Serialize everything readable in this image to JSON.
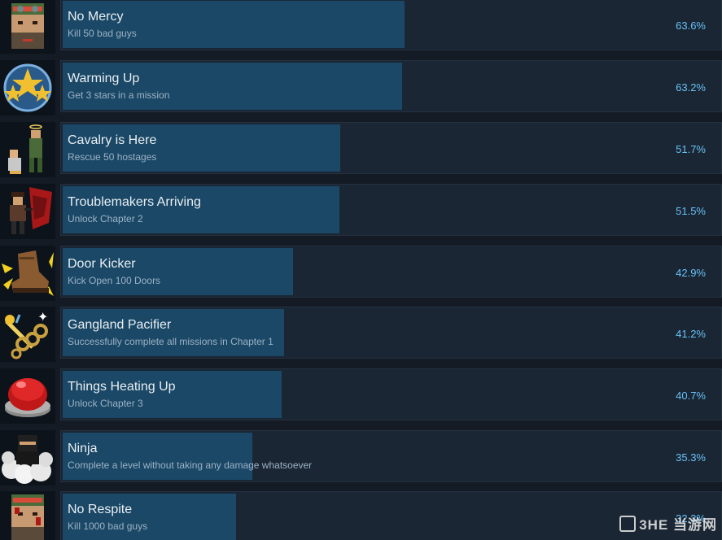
{
  "achievements": [
    {
      "title": "No Mercy",
      "description": "Kill 50 bad guys",
      "percent_label": "63.6%",
      "percent": 63.6,
      "icon": "soldier-face-icon"
    },
    {
      "title": "Warming Up",
      "description": "Get 3 stars in a mission",
      "percent_label": "63.2%",
      "percent": 63.2,
      "icon": "three-stars-badge-icon"
    },
    {
      "title": "Cavalry is Here",
      "description": "Rescue 50 hostages",
      "percent_label": "51.7%",
      "percent": 51.7,
      "icon": "soldier-hostage-icon"
    },
    {
      "title": "Troublemakers Arriving",
      "description": "Unlock Chapter 2",
      "percent_label": "51.5%",
      "percent": 51.5,
      "icon": "gunman-red-flag-icon"
    },
    {
      "title": "Door Kicker",
      "description": "Kick Open 100 Doors",
      "percent_label": "42.9%",
      "percent": 42.9,
      "icon": "kicking-boot-icon"
    },
    {
      "title": "Gangland Pacifier",
      "description": "Successfully complete all missions in Chapter 1",
      "percent_label": "41.2%",
      "percent": 41.2,
      "icon": "brass-knuckles-icon"
    },
    {
      "title": "Things Heating Up",
      "description": "Unlock Chapter 3",
      "percent_label": "40.7%",
      "percent": 40.7,
      "icon": "red-alarm-button-icon"
    },
    {
      "title": "Ninja",
      "description": "Complete a level without taking any damage whatsoever",
      "percent_label": "35.3%",
      "percent": 35.3,
      "icon": "ninja-smoke-icon"
    },
    {
      "title": "No Respite",
      "description": "Kill 1000 bad guys",
      "percent_label": "32.3%",
      "percent": 32.3,
      "icon": "bloody-soldier-face-icon"
    }
  ],
  "watermark": {
    "text": "3HE 当游网",
    "name": "watermark-logo"
  },
  "colors": {
    "background": "#141b24",
    "card": "#1a2634",
    "progress_fill": "#1a4866",
    "title_text": "#e9eef3",
    "description_text": "#9db2c6",
    "percent_text": "#67c1f5"
  }
}
